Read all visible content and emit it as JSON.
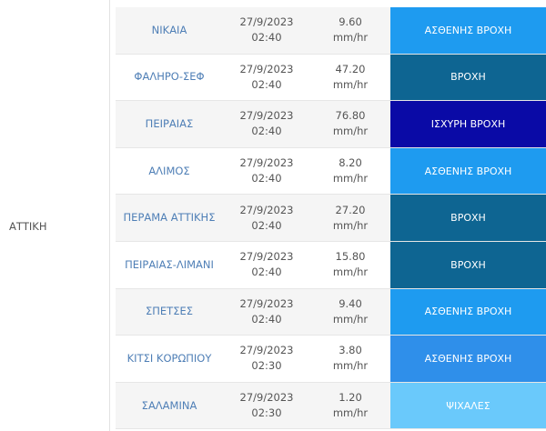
{
  "region": "ΑΤΤΙΚΗ",
  "unit": "mm/hr",
  "category_colors": {
    "ΑΣΘΕΝΗΣ ΒΡΟΧΗ": "#1e9bf0",
    "ΒΡΟΧΗ": "#0e6592",
    "ΙΣΧΥΡΗ ΒΡΟΧΗ": "#0a0aa6",
    "ΨΙΧΑΛΕΣ": "#6ac9fb"
  },
  "rows": [
    {
      "station": "ΝΙΚΑΙΑ",
      "date": "27/9/2023",
      "time": "02:40",
      "value": "9.60",
      "unit": "mm/hr",
      "category": "ΑΣΘΕΝΗΣ ΒΡΟΧΗ",
      "color": "#1e9bf0"
    },
    {
      "station": "ΦΑΛΗΡΟ-ΣΕΦ",
      "date": "27/9/2023",
      "time": "02:40",
      "value": "47.20",
      "unit": "mm/hr",
      "category": "ΒΡΟΧΗ",
      "color": "#0e6592"
    },
    {
      "station": "ΠΕΙΡΑΙΑΣ",
      "date": "27/9/2023",
      "time": "02:40",
      "value": "76.80",
      "unit": "mm/hr",
      "category": "ΙΣΧΥΡΗ ΒΡΟΧΗ",
      "color": "#0a0aa6"
    },
    {
      "station": "ΑΛΙΜΟΣ",
      "date": "27/9/2023",
      "time": "02:40",
      "value": "8.20",
      "unit": "mm/hr",
      "category": "ΑΣΘΕΝΗΣ ΒΡΟΧΗ",
      "color": "#1e9bf0"
    },
    {
      "station": "ΠΕΡΑΜΑ ΑΤΤΙΚΗΣ",
      "date": "27/9/2023",
      "time": "02:40",
      "value": "27.20",
      "unit": "mm/hr",
      "category": "ΒΡΟΧΗ",
      "color": "#0e6592"
    },
    {
      "station": "ΠΕΙΡΑΙΑΣ-ΛΙΜΑΝΙ",
      "date": "27/9/2023",
      "time": "02:40",
      "value": "15.80",
      "unit": "mm/hr",
      "category": "ΒΡΟΧΗ",
      "color": "#0e6592"
    },
    {
      "station": "ΣΠΕΤΣΕΣ",
      "date": "27/9/2023",
      "time": "02:40",
      "value": "9.40",
      "unit": "mm/hr",
      "category": "ΑΣΘΕΝΗΣ ΒΡΟΧΗ",
      "color": "#1e9bf0"
    },
    {
      "station": "ΚΙΤΣΙ ΚΟΡΩΠΙΟΥ",
      "date": "27/9/2023",
      "time": "02:30",
      "value": "3.80",
      "unit": "mm/hr",
      "category": "ΑΣΘΕΝΗΣ ΒΡΟΧΗ",
      "color": "#2f8fea"
    },
    {
      "station": "ΣΑΛΑΜΙΝΑ",
      "date": "27/9/2023",
      "time": "02:30",
      "value": "1.20",
      "unit": "mm/hr",
      "category": "ΨΙΧΑΛΕΣ",
      "color": "#6ac9fb"
    }
  ]
}
